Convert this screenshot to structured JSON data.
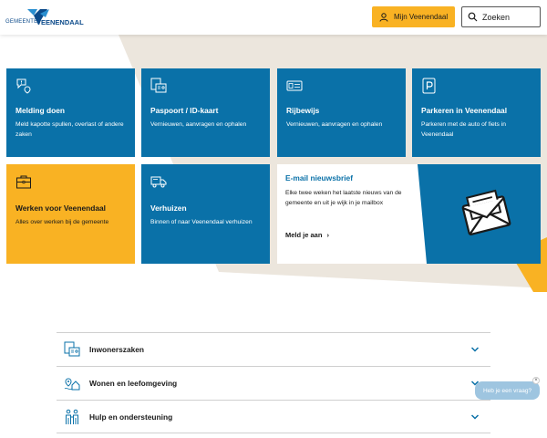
{
  "header": {
    "logo_prefix": "GEMEENTE",
    "logo_name": "VEENENDAAL",
    "account_button": "Mijn Veenendaal",
    "search_placeholder": "Zoeken"
  },
  "tiles": [
    {
      "title": "Melding doen",
      "desc": "Meld kapotte spullen, overlast of andere zaken",
      "icon": "report-location-icon"
    },
    {
      "title": "Paspoort / ID-kaart",
      "desc": "Vernieuwen, aanvragen en ophalen",
      "icon": "passport-icon"
    },
    {
      "title": "Rijbewijs",
      "desc": "Vernieuwen, aanvragen en ophalen",
      "icon": "drivers-license-icon"
    },
    {
      "title": "Parkeren in Veenendaal",
      "desc": "Parkeren met de auto of fiets in Veenendaal",
      "icon": "parking-icon"
    },
    {
      "title": "Werken voor Veenendaal",
      "desc": "Alles over werken bij de gemeente",
      "icon": "briefcase-icon"
    },
    {
      "title": "Verhuizen",
      "desc": "Binnen of naar Veenendaal verhuizen",
      "icon": "moving-truck-icon"
    }
  ],
  "newsletter": {
    "title": "E-mail nieuwsbrief",
    "desc": "Elke twee weken het laatste nieuws van de gemeente en uit je wijk in je mailbox",
    "link": "Meld je aan"
  },
  "accordion": [
    {
      "label": "Inwonerszaken",
      "icon": "id-card-icon"
    },
    {
      "label": "Wonen en leefomgeving",
      "icon": "location-home-icon"
    },
    {
      "label": "Hulp en ondersteuning",
      "icon": "people-icon"
    }
  ],
  "chat": {
    "label": "Heb je een vraag?",
    "close": "×"
  },
  "colors": {
    "blue": "#0a71a8",
    "yellow": "#f9b223",
    "beige": "#ece6dd"
  }
}
